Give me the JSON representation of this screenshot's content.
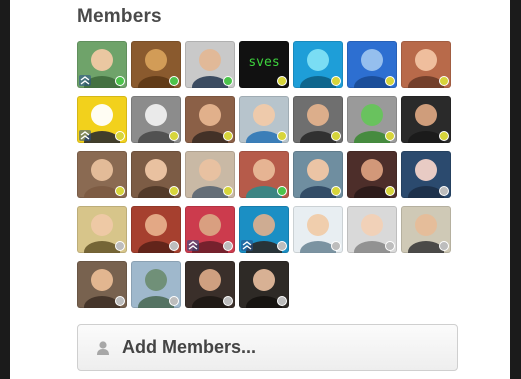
{
  "members_panel": {
    "title": "Members",
    "add_button_label": "Add Members...",
    "add_button_icon": "person-icon"
  },
  "members": [
    {
      "name": "member-1",
      "bg": "#6fa36a",
      "skin": "#f0c9a4",
      "shirt": "#3f6b3d",
      "status": "online",
      "admin": true
    },
    {
      "name": "member-2",
      "bg": "#8a5a2e",
      "skin": "#d6a05a",
      "shirt": "#5c3716",
      "status": "online",
      "admin": false,
      "label": ""
    },
    {
      "name": "member-3",
      "bg": "#c9c9c9",
      "skin": "#e3b896",
      "shirt": "#2c3e55",
      "status": "online",
      "admin": false
    },
    {
      "name": "member-4",
      "bg": "#111111",
      "skin": "#111111",
      "shirt": "#111111",
      "status": "active",
      "admin": false,
      "label": "sves"
    },
    {
      "name": "member-5",
      "bg": "#1e9ed8",
      "skin": "#7fe0f5",
      "shirt": "#0d5f85",
      "status": "active",
      "admin": false
    },
    {
      "name": "member-6",
      "bg": "#2d6fd1",
      "skin": "#9bc3ef",
      "shirt": "#1a4a93",
      "status": "active",
      "admin": false
    },
    {
      "name": "member-7",
      "bg": "#b86a4a",
      "skin": "#f1c3a1",
      "shirt": "#6b3b28",
      "status": "active",
      "admin": false
    },
    {
      "name": "member-8",
      "bg": "#f2d11c",
      "skin": "#ffffff",
      "shirt": "#2d2d2d",
      "status": "active",
      "admin": true
    },
    {
      "name": "member-9",
      "bg": "#8c8c8c",
      "skin": "#efefef",
      "shirt": "#4a4a4a",
      "status": "active",
      "admin": false
    },
    {
      "name": "member-10",
      "bg": "#8b6047",
      "skin": "#e6b48f",
      "shirt": "#3b2c24",
      "status": "active",
      "admin": false
    },
    {
      "name": "member-11",
      "bg": "#b7c4cc",
      "skin": "#f0caa9",
      "shirt": "#2e77b6",
      "status": "active",
      "admin": false
    },
    {
      "name": "member-12",
      "bg": "#6f6f6f",
      "skin": "#e2b18c",
      "shirt": "#2a2a2a",
      "status": "active",
      "admin": false
    },
    {
      "name": "member-13",
      "bg": "#9a9a9a",
      "skin": "#66c45b",
      "shirt": "#3d8a35",
      "status": "active",
      "admin": false
    },
    {
      "name": "member-14",
      "bg": "#2a2a2a",
      "skin": "#d8a37f",
      "shirt": "#1a1a1a",
      "status": "active",
      "admin": false
    },
    {
      "name": "member-15",
      "bg": "#8a6a52",
      "skin": "#e8c09c",
      "shirt": "#7b5a41",
      "status": "active",
      "admin": false
    },
    {
      "name": "member-16",
      "bg": "#7c5c45",
      "skin": "#efc6a5",
      "shirt": "#4e3626",
      "status": "active",
      "admin": false
    },
    {
      "name": "member-17",
      "bg": "#c9b9a5",
      "skin": "#eac1a0",
      "shirt": "#5a6672",
      "status": "active",
      "admin": false
    },
    {
      "name": "member-18",
      "bg": "#b65b4a",
      "skin": "#e9b997",
      "shirt": "#2f8a8a",
      "status": "online",
      "admin": false
    },
    {
      "name": "member-19",
      "bg": "#6f8ea0",
      "skin": "#f1c7a5",
      "shirt": "#2c4660",
      "status": "active",
      "admin": false
    },
    {
      "name": "member-20",
      "bg": "#4d2e2a",
      "skin": "#d99e7d",
      "shirt": "#2a1a18",
      "status": "active",
      "admin": false
    },
    {
      "name": "member-21",
      "bg": "#2b4a6e",
      "skin": "#f2d2c8",
      "shirt": "#1c2f47",
      "status": "idle",
      "admin": false
    },
    {
      "name": "member-22",
      "bg": "#d7c58a",
      "skin": "#efc9a6",
      "shirt": "#6a5a2c",
      "status": "idle",
      "admin": false
    },
    {
      "name": "member-23",
      "bg": "#a6402f",
      "skin": "#e6ae8a",
      "shirt": "#5b2118",
      "status": "idle",
      "admin": false
    },
    {
      "name": "member-24",
      "bg": "#cc3b4d",
      "skin": "#d9a483",
      "shirt": "#6d1f2a",
      "status": "idle",
      "admin": true
    },
    {
      "name": "member-25",
      "bg": "#1b8fc4",
      "skin": "#d8ae8f",
      "shirt": "#2a2a2a",
      "status": "idle",
      "admin": true
    },
    {
      "name": "member-26",
      "bg": "#e8eef2",
      "skin": "#f0cba9",
      "shirt": "#6f8898",
      "status": "idle",
      "admin": false
    },
    {
      "name": "member-27",
      "bg": "#d9d9d9",
      "skin": "#f2d1b6",
      "shirt": "#8a8a8a",
      "status": "idle",
      "admin": false
    },
    {
      "name": "member-28",
      "bg": "#cfc9b6",
      "skin": "#e6bd99",
      "shirt": "#3c3c3c",
      "status": "idle",
      "admin": false
    },
    {
      "name": "member-29",
      "bg": "#78624f",
      "skin": "#e8bb93",
      "shirt": "#3f3126",
      "status": "idle",
      "admin": false
    },
    {
      "name": "member-30",
      "bg": "#9fb8cc",
      "skin": "#6e8d73",
      "shirt": "#4d6b58",
      "status": "idle",
      "admin": false
    },
    {
      "name": "member-31",
      "bg": "#3a2f2a",
      "skin": "#d7a785",
      "shirt": "#1e1814",
      "status": "idle",
      "admin": false
    },
    {
      "name": "member-32",
      "bg": "#2e2a26",
      "skin": "#e2b89a",
      "shirt": "#151210",
      "status": "idle",
      "admin": false
    }
  ]
}
